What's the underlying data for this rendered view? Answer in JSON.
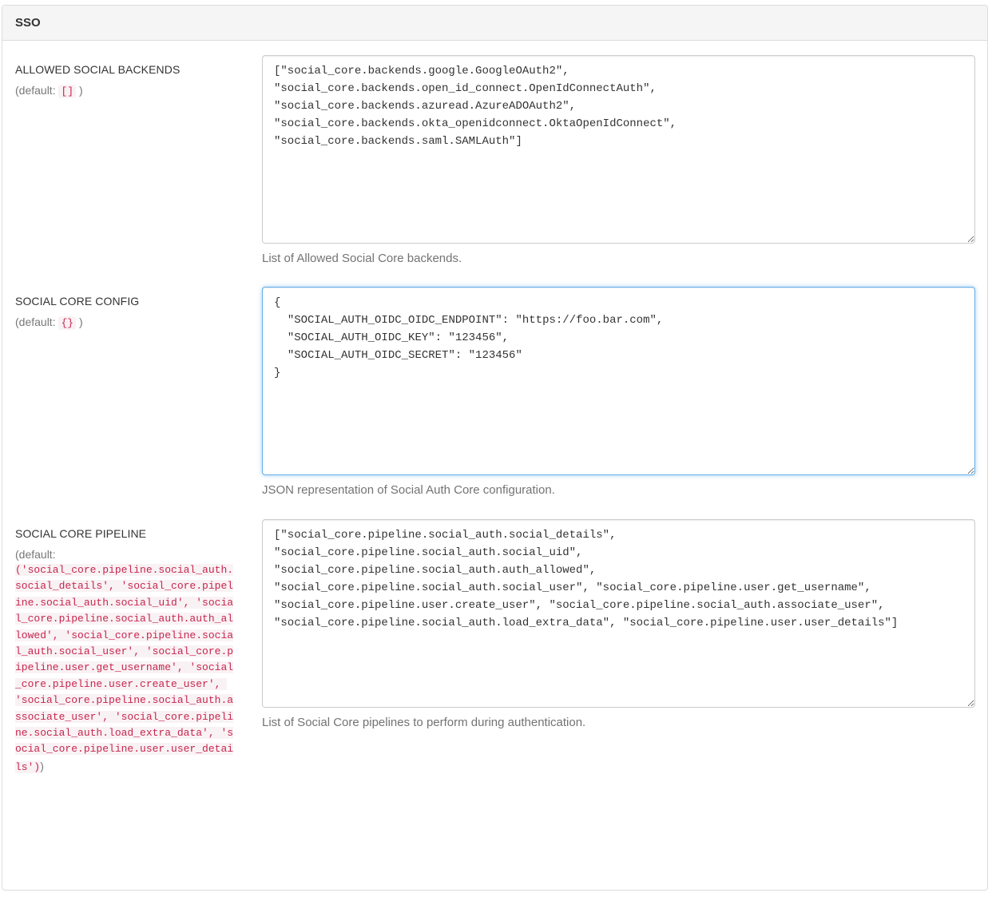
{
  "panel": {
    "title": "SSO"
  },
  "settings": [
    {
      "name": "ALLOWED SOCIAL BACKENDS",
      "default_prefix": "(default: ",
      "default_value": "[]",
      "default_suffix": ")",
      "value": "[\"social_core.backends.google.GoogleOAuth2\",\n\"social_core.backends.open_id_connect.OpenIdConnectAuth\",\n\"social_core.backends.azuread.AzureADOAuth2\",\n\"social_core.backends.okta_openidconnect.OktaOpenIdConnect\",\n\"social_core.backends.saml.SAMLAuth\"]",
      "help": "List of Allowed Social Core backends."
    },
    {
      "name": "SOCIAL CORE CONFIG",
      "default_prefix": "(default: ",
      "default_value": "{}",
      "default_suffix": ")",
      "value": "{\n  \"SOCIAL_AUTH_OIDC_OIDC_ENDPOINT\": \"https://foo.bar.com\",\n  \"SOCIAL_AUTH_OIDC_KEY\": \"123456\",\n  \"SOCIAL_AUTH_OIDC_SECRET\": \"123456\"\n}",
      "help": "JSON representation of Social Auth Core configuration."
    },
    {
      "name": "SOCIAL CORE PIPELINE",
      "default_prefix": "(default:",
      "default_value": "('social_core.pipeline.social_auth.social_details', 'social_core.pipeline.social_auth.social_uid', 'social_core.pipeline.social_auth.auth_allowed', 'social_core.pipeline.social_auth.social_user', 'social_core.pipeline.user.get_username', 'social_core.pipeline.user.create_user', 'social_core.pipeline.social_auth.associate_user', 'social_core.pipeline.social_auth.load_extra_data', 'social_core.pipeline.user.user_details')",
      "default_suffix": ")",
      "value": "[\"social_core.pipeline.social_auth.social_details\",\n\"social_core.pipeline.social_auth.social_uid\",\n\"social_core.pipeline.social_auth.auth_allowed\",\n\"social_core.pipeline.social_auth.social_user\", \"social_core.pipeline.user.get_username\",\n\"social_core.pipeline.user.create_user\", \"social_core.pipeline.social_auth.associate_user\",\n\"social_core.pipeline.social_auth.load_extra_data\", \"social_core.pipeline.user.user_details\"]",
      "help": "List of Social Core pipelines to perform during authentication."
    }
  ]
}
